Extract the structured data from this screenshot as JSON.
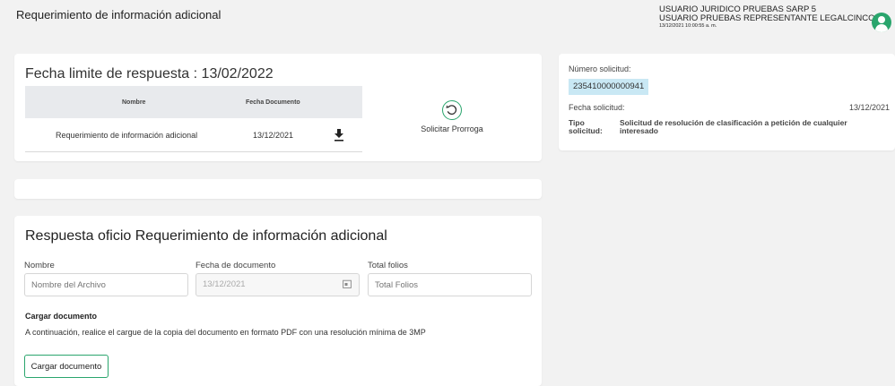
{
  "page": {
    "title": "Requerimiento de información adicional"
  },
  "user": {
    "line1": "USUARIO JURIDICO PRUEBAS SARP 5",
    "line2": "USUARIO PRUEBAS REPRESENTANTE LEGALCINCO",
    "date": "13/12/2021 10:00:55 a. m."
  },
  "deadline": {
    "label": "Fecha limite de respuesta : 13/02/2022"
  },
  "documents_table": {
    "columns": [
      "Nombre",
      "Fecha Documento"
    ],
    "rows": [
      {
        "name": "Requerimiento de información adicional",
        "date": "13/12/2021"
      }
    ]
  },
  "prorroga": {
    "label": "Solicitar Prorroga"
  },
  "response": {
    "title": "Respuesta oficio Requerimiento de información adicional",
    "name_label": "Nombre",
    "name_placeholder": "Nombre del Archivo",
    "date_label": "Fecha de documento",
    "date_value": "13/12/2021",
    "folios_label": "Total folios",
    "folios_placeholder": "Total Folios",
    "upload_heading": "Cargar documento",
    "upload_note": "A continuación, realice el cargue de la copia del documento en formato PDF con una resolución mínima de 3MP",
    "upload_button": "Cargar documento"
  },
  "solicitud": {
    "numero_label": "Número solicitud:",
    "numero_value": "235410000000941",
    "fecha_label": "Fecha solicitud:",
    "fecha_value": "13/12/2021",
    "tipo_label": "Tipo solicitud:",
    "tipo_value": "Solicitud de resolución de clasificación a petición de cualquier interesado"
  },
  "colors": {
    "accent": "#2aa56d",
    "chip": "#c9e8f4",
    "table_header": "#e8eaed"
  }
}
